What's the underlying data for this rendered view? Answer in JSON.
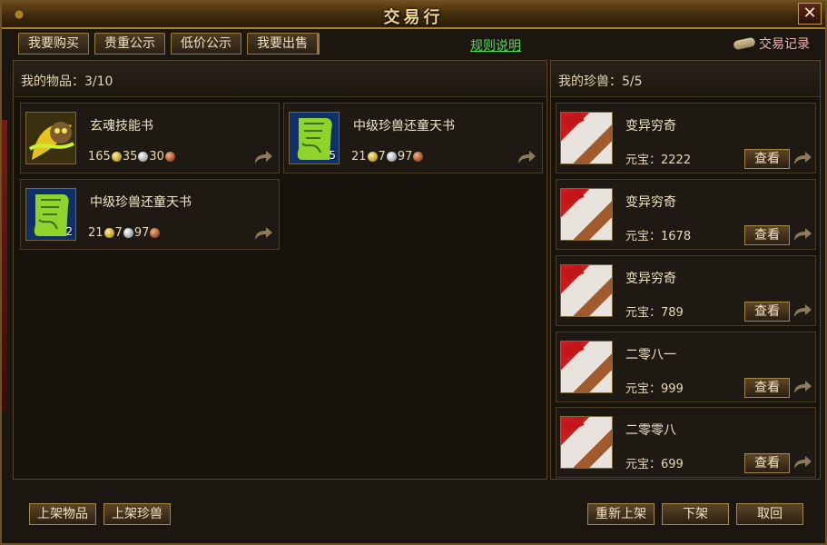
{
  "window": {
    "title": "交易行",
    "close_label": "✕"
  },
  "tabs": [
    {
      "label": "我要购买"
    },
    {
      "label": "贵重公示"
    },
    {
      "label": "低价公示"
    },
    {
      "label": "我要出售"
    }
  ],
  "rules_link": "规则说明",
  "history_label": "交易记录",
  "items_panel": {
    "header": "我的物品：3/10",
    "items": [
      {
        "name": "玄魂技能书",
        "gold": "165",
        "silver": "35",
        "copper": "30",
        "icon": "skill-book-icon"
      },
      {
        "name": "中级珍兽还童天书",
        "gold": "21",
        "silver": "7",
        "copper": "97",
        "count": "5",
        "icon": "scroll-icon"
      },
      {
        "name": "中级珍兽还童天书",
        "gold": "21",
        "silver": "7",
        "copper": "97",
        "count": "2",
        "icon": "scroll-icon"
      }
    ]
  },
  "beasts_panel": {
    "header": "我的珍兽：5/5",
    "view_label": "查看",
    "beasts": [
      {
        "name": "变异穷奇",
        "price": "元宝：2222"
      },
      {
        "name": "变异穷奇",
        "price": "元宝：1678"
      },
      {
        "name": "变异穷奇",
        "price": "元宝：789"
      },
      {
        "name": "二零八一",
        "price": "元宝：999"
      },
      {
        "name": "二零零八",
        "price": "元宝：699"
      }
    ]
  },
  "bottom": {
    "list_items": "上架物品",
    "list_beasts": "上架珍兽",
    "relist": "重新上架",
    "delist": "下架",
    "retrieve": "取回"
  }
}
